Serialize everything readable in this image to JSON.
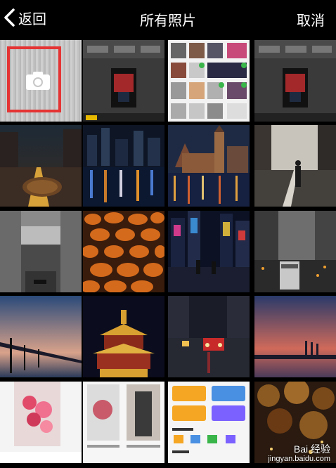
{
  "header": {
    "back_label": "返回",
    "title": "所有照片",
    "cancel_label": "取消"
  },
  "watermark": {
    "text": "Bai 经验",
    "url": "jingyan.baidu.com"
  },
  "colors": {
    "header_bg": "#000000",
    "highlight_border": "#e53434",
    "text": "#ffffff"
  },
  "grid": {
    "camera_tile_icon": "camera-icon",
    "photos": [
      "screenshot-video-editor-1",
      "screenshot-photo-picker-grid",
      "screenshot-video-editor-2",
      "city-street-night-manhole",
      "city-river-night-reflections",
      "castle-night-lights",
      "woman-walking-road",
      "venice-canal-bridge",
      "cobblestones-orange-lights",
      "neon-street-rain-night",
      "train-city-dusk",
      "pier-sunset-blue",
      "chinese-pavilion-night",
      "street-traffic-rain",
      "bridge-sunset-purple",
      "screenshot-flowers-app",
      "screenshot-app-cards",
      "screenshot-video-tools",
      "autumn-tree-lights"
    ]
  }
}
